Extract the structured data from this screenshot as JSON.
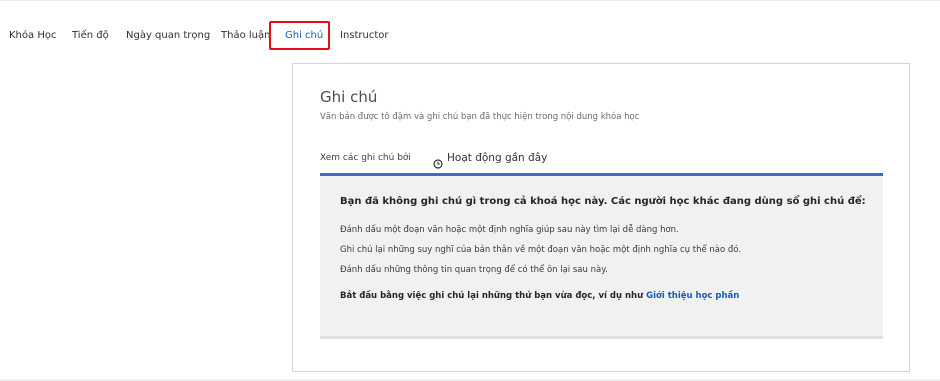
{
  "course_nav": {
    "tabs": [
      {
        "label": "Khóa Học",
        "active": false
      },
      {
        "label": "Tiến độ",
        "active": false
      },
      {
        "label": "Ngày quan trọng",
        "active": false
      },
      {
        "label": "Thảo luận",
        "active": false
      },
      {
        "label": "Ghi chú",
        "active": true
      },
      {
        "label": "Instructor",
        "active": false
      }
    ]
  },
  "notes": {
    "title": "Ghi chú",
    "subtitle": "Văn bản được tô đậm và ghi chú bạn đã thực hiện trong nội dung khóa học",
    "view_label": "Xem các ghi chú bởi",
    "active_view": "Hoạt động gần đây",
    "active_view_icon": "clock-icon",
    "empty_state": {
      "heading": "Bạn đã không ghi chú gì trong cả khoá học này. Các người học khác đang dùng sổ ghi chú để:",
      "tips": [
        "Đánh dấu một đoạn văn hoặc một định nghĩa giúp sau này tìm lại dễ dàng hơn.",
        "Ghi chú lại những suy nghĩ của bản thân về một đoạn văn hoặc một định nghĩa cụ thể nào đó.",
        "Đánh dấu những thông tin quan trọng để có thể ôn lại sau này."
      ],
      "cta_text": "Bắt đầu bằng việc ghi chú lại những thứ bạn vừa đọc, ví dụ như",
      "cta_link": "Giới thiệu học phần"
    }
  },
  "colors": {
    "active_tab_text": "#0e64c0",
    "highlight_frame": "#e2101a",
    "box_top_border": "#3a6ec3",
    "link": "#0e5fb8",
    "box_background": "#f1f1f1"
  }
}
